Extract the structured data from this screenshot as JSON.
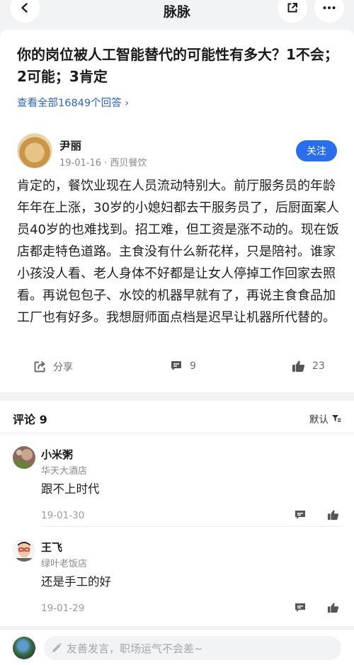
{
  "nav": {
    "title": "脉脉"
  },
  "question": {
    "title": "你的岗位被人工智能替代的可能性有多大？1不会；2可能；3肯定",
    "view_all": "查看全部16849个回答 ›"
  },
  "answer": {
    "author": "尹丽",
    "meta": "19-01-16 · 西贝餐饮",
    "follow_label": "关注",
    "body": "肯定的，餐饮业现在人员流动特别大。前厅服务员的年龄年年在上涨，30岁的小媳妇都去干服务员了，后厨面案人员40岁的也难找到。招工难，但工资是涨不动的。现在饭店都走特色道路。主食没有什么新花样，只是陪衬。谁家小孩没人看、老人身体不好都是让女人停掉工作回家去照看。再说包包子、水饺的机器早就有了，再说主食食品加工厂也有好多。我想厨师面点档是迟早让机器所代替的。",
    "share_label": "分享",
    "comment_count": "9",
    "like_count": "23"
  },
  "comments": {
    "header": "评论 9",
    "sort_label": "默认",
    "items": [
      {
        "name": "小米粥",
        "company": "华天大酒店",
        "text": "跟不上时代",
        "date": "19-01-30"
      },
      {
        "name": "王飞",
        "company": "绿叶老饭店",
        "text": "还是手工的好",
        "date": "19-01-29"
      }
    ]
  },
  "composer": {
    "placeholder": "友善发言，职场运气不会差~"
  }
}
